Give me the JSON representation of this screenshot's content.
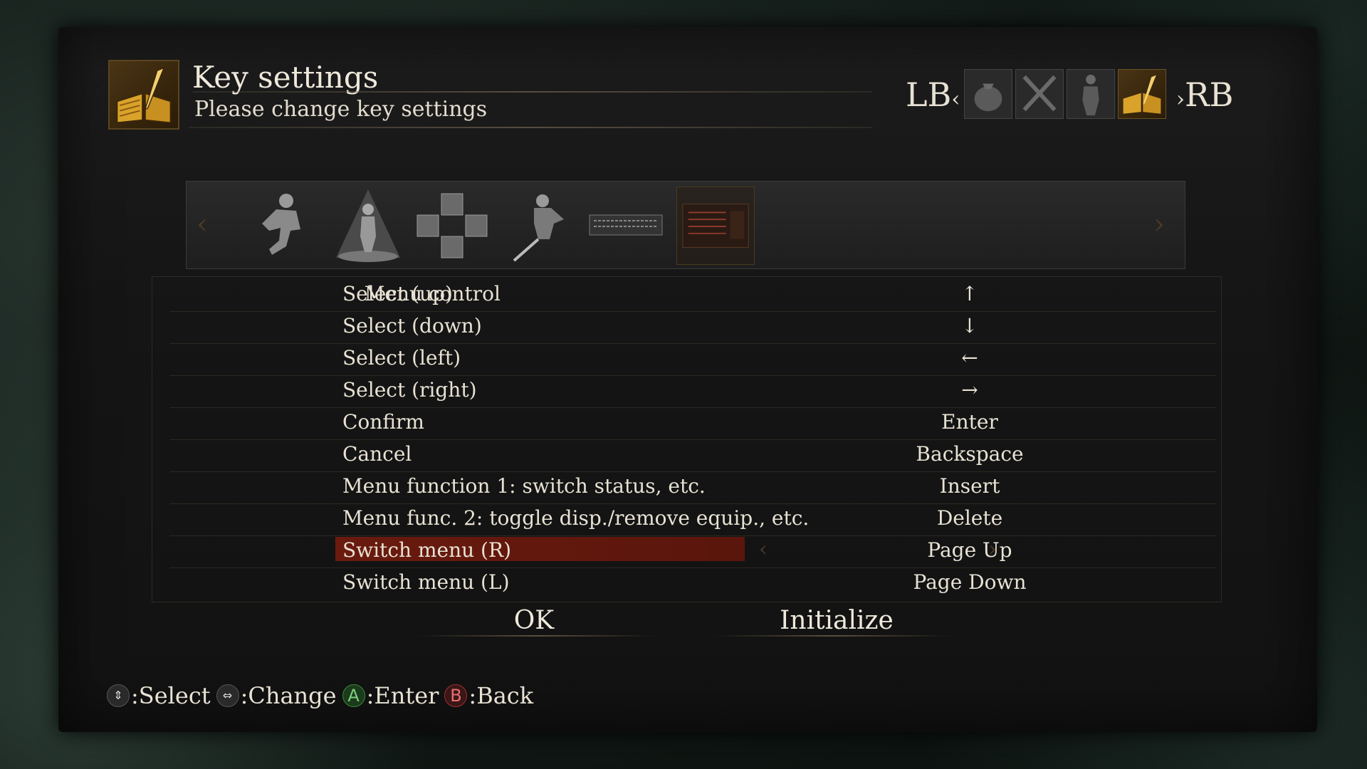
{
  "header": {
    "title": "Key settings",
    "subtitle": "Please change key settings",
    "icon": "book-quill-icon"
  },
  "top_tabs": {
    "left_label": "LB",
    "left_chevron": "‹",
    "right_chevron": "›",
    "right_label": "RB",
    "icons": [
      "item-pouch-icon",
      "crossed-swords-icon",
      "character-silhouette-icon",
      "book-quill-icon"
    ],
    "active_index": 3
  },
  "category_strip": {
    "left_arrow": "‹",
    "right_arrow": "›",
    "icons": [
      "running-figure-icon",
      "character-pedestal-icon",
      "item-slots-icon",
      "knight-attack-icon",
      "keyboard-icon",
      "menu-screen-icon"
    ],
    "selected_index": 5
  },
  "rows": [
    {
      "category": "Menu control",
      "action": "Select (up)",
      "key": "↑"
    },
    {
      "category": "",
      "action": "Select (down)",
      "key": "↓"
    },
    {
      "category": "",
      "action": "Select (left)",
      "key": "←"
    },
    {
      "category": "",
      "action": "Select (right)",
      "key": "→"
    },
    {
      "category": "",
      "action": "Confirm",
      "key": "Enter"
    },
    {
      "category": "",
      "action": "Cancel",
      "key": "Backspace"
    },
    {
      "category": "",
      "action": "Menu function 1: switch status, etc.",
      "key": "Insert"
    },
    {
      "category": "",
      "action": "Menu func. 2: toggle disp./remove equip., etc.",
      "key": "Delete"
    },
    {
      "category": "",
      "action": "Switch menu (R)",
      "key": "Page Up",
      "left_arrow": "‹",
      "right_arrow": "›"
    },
    {
      "category": "",
      "action": "Switch menu (L)",
      "key": "Page Down"
    }
  ],
  "selected_row": 8,
  "buttons": {
    "ok": "OK",
    "initialize": "Initialize"
  },
  "hints": [
    {
      "icon": "dpad-updown-icon",
      "glyph": "⇕",
      "label": ":Select"
    },
    {
      "icon": "dpad-leftright-icon",
      "glyph": "⇔",
      "label": ":Change"
    },
    {
      "icon": "a-button-icon",
      "glyph": "A",
      "label": ":Enter"
    },
    {
      "icon": "b-button-icon",
      "glyph": "B",
      "label": ":Back"
    }
  ],
  "colors": {
    "highlight": "#6a1a0e",
    "text": "#e8e2d4",
    "a_button": "#3a8a3a",
    "b_button": "#a03030"
  }
}
